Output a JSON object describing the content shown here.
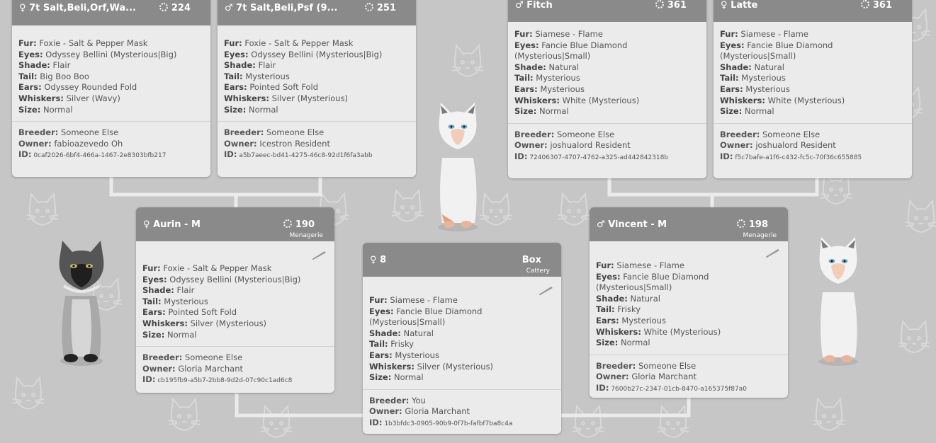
{
  "labels": {
    "fur": "Fur:",
    "eyes": "Eyes:",
    "shade": "Shade:",
    "tail": "Tail:",
    "ears": "Ears:",
    "whiskers": "Whiskers:",
    "size": "Size:",
    "breeder": "Breeder:",
    "owner": "Owner:",
    "id": "ID:"
  },
  "cards": [
    {
      "gender": "♀",
      "name": "7t Salt,Beli,Orf,Wa...",
      "number": "224",
      "tag": "",
      "fur": "Foxie - Salt & Pepper Mask",
      "eyes": "Odyssey Bellini (Mysterious|Big)",
      "shade": "Flair",
      "tail": "Big Boo Boo",
      "ears": "Odyssey Rounded Fold",
      "whiskers": "Silver (Wavy)",
      "size": "Normal",
      "breeder": "Someone Else",
      "owner": "fabioazevedo Oh",
      "id": "0caf2026-6bf4-466a-1467-2e8303bfb217"
    },
    {
      "gender": "♂",
      "name": "7t Salt,Beli,Psf (9...",
      "number": "251",
      "tag": "",
      "fur": "Foxie - Salt & Pepper Mask",
      "eyes": "Odyssey Bellini (Mysterious|Big)",
      "shade": "Flair",
      "tail": "Mysterious",
      "ears": "Pointed Soft Fold",
      "whiskers": "Silver (Mysterious)",
      "size": "Normal",
      "breeder": "Someone Else",
      "owner": "Icestron Resident",
      "id": "a5b7aeec-bd41-4275-46c8-92d1f6fa3abb"
    },
    {
      "gender": "♂",
      "name": "Fitch",
      "number": "361",
      "tag": "",
      "fur": "Siamese - Flame",
      "eyes": "Fancie Blue Diamond (Mysterious|Small)",
      "shade": "Natural",
      "tail": "Mysterious",
      "ears": "Mysterious",
      "whiskers": "White (Mysterious)",
      "size": "Normal",
      "breeder": "Someone Else",
      "owner": "joshualord Resident",
      "id": "72406307-4707-4762-a325-ad442842318b"
    },
    {
      "gender": "♀",
      "name": "Latte",
      "number": "361",
      "tag": "",
      "fur": "Siamese - Flame",
      "eyes": "Fancie Blue Diamond (Mysterious|Small)",
      "shade": "Natural",
      "tail": "Mysterious",
      "ears": "Mysterious",
      "whiskers": "White (Mysterious)",
      "size": "Normal",
      "breeder": "Someone Else",
      "owner": "joshualord Resident",
      "id": "f5c7bafe-a1f6-c432-fc5c-70f36c655885"
    },
    {
      "gender": "♀",
      "name": "Aurin - M",
      "number": "190",
      "tag": "Menagerie",
      "fur": "Foxie - Salt & Pepper Mask",
      "eyes": "Odyssey Bellini (Mysterious|Big)",
      "shade": "Flair",
      "tail": "Mysterious",
      "ears": "Pointed Soft Fold",
      "whiskers": "Silver (Mysterious)",
      "size": "Normal",
      "breeder": "Someone Else",
      "owner": "Gloria Marchant",
      "id": "cb195fb9-a5b7-2bb8-9d2d-07c90c1ad6c8"
    },
    {
      "gender": "♀",
      "name": "8",
      "number": "Box",
      "tag": "Cattery",
      "fur": "Siamese - Flame",
      "eyes": "Fancie Blue Diamond (Mysterious|Small)",
      "shade": "Natural",
      "tail": "Frisky",
      "ears": "Mysterious",
      "whiskers": "Silver (Mysterious)",
      "size": "Normal",
      "breeder": "You",
      "owner": "Gloria Marchant",
      "id": "1b3bfdc3-0905-90b9-0f7b-fafbf7ba8c4a"
    },
    {
      "gender": "♂",
      "name": "Vincent - M",
      "number": "198",
      "tag": "Menagerie",
      "fur": "Siamese - Flame",
      "eyes": "Fancie Blue Diamond (Mysterious|Small)",
      "shade": "Natural",
      "tail": "Frisky",
      "ears": "Mysterious",
      "whiskers": "White (Mysterious)",
      "size": "Normal",
      "breeder": "Someone Else",
      "owner": "Gloria Marchant",
      "id": "7600b27c-2347-01cb-8470-a165375f87a0"
    }
  ],
  "colors": {
    "header": "#8a8a8a",
    "card": "#ebebeb",
    "background": "#c6c6c6",
    "connector": "#ebebeb"
  }
}
